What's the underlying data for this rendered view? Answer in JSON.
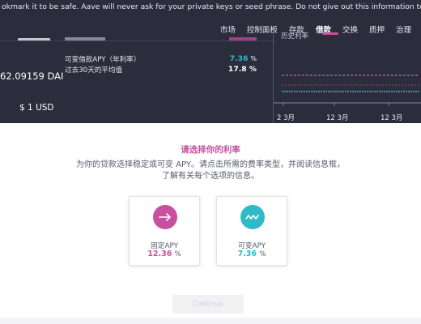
{
  "warning": {
    "text": "okmark it to be safe. Aave will never ask for your private keys or seed phrase. Do not give out this information to anyone or any site."
  },
  "nav": {
    "items": [
      "市场",
      "控制面板",
      "存款",
      "借款",
      "交换",
      "质押",
      "治理"
    ],
    "active": "借款"
  },
  "summary": {
    "balance": "62.09159 DAI",
    "price_prefix": "$",
    "price_value": "1",
    "price_unit": "USD"
  },
  "rates": {
    "variable_label": "可变借款APY（年利率）",
    "variable_value": "7.36",
    "variable_unit": "%",
    "avg_label": "过去30天的平均值",
    "avg_value": "17.8 %"
  },
  "history_chart": {
    "title": "历史利率",
    "legend_color": "#c8509f",
    "chart_data": {
      "type": "line",
      "title": "历史利率",
      "x_ticks": [
        "2 3月",
        "12 3月",
        "12 3月"
      ],
      "series_colors": [
        "#c8509f",
        "#2ebac6"
      ]
    }
  },
  "select": {
    "title": "请选择你的利率",
    "description": "为你的贷款选择稳定或可变 APY。请点击所需的费率类型，并阅读信息框，了解有关每个选项的信息。"
  },
  "options": {
    "fixed": {
      "label": "固定APY",
      "value": "12.36",
      "unit": "%",
      "icon": "arrow-right-icon",
      "color": "#c8509f"
    },
    "variable": {
      "label": "可变APY",
      "value": "7.36",
      "unit": "%",
      "icon": "wave-icon",
      "color": "#2ebac6"
    }
  },
  "continue_label": "Continue"
}
